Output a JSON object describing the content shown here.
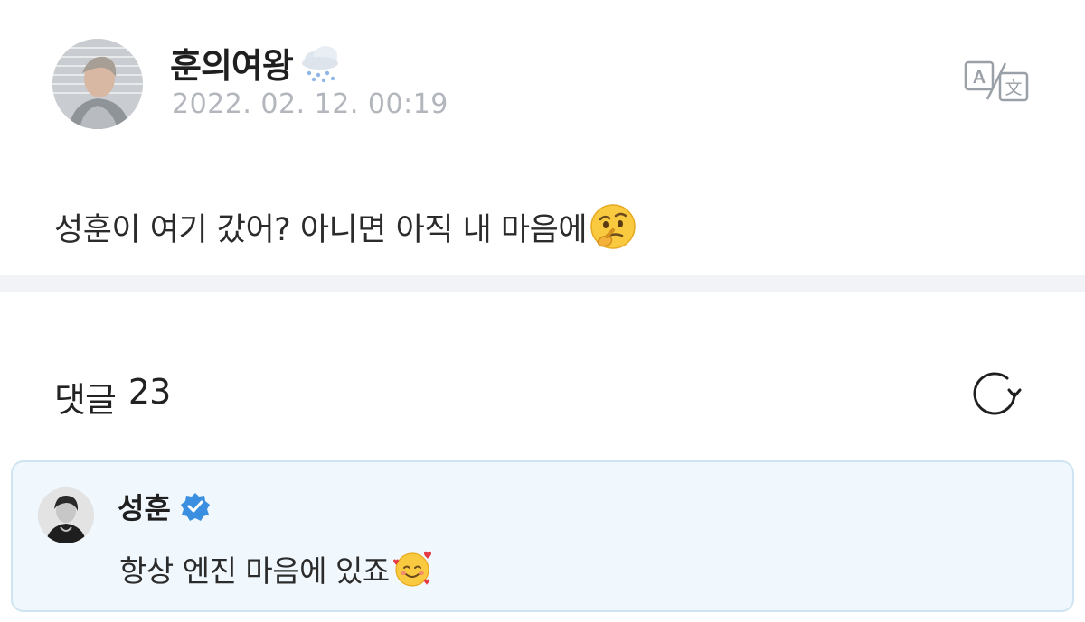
{
  "post": {
    "author": "훈의여왕",
    "author_emoji_icon": "cloud-snow-icon",
    "date": "2022. 02. 12. 00:19",
    "body": "성훈이 여기 갔어? 아니면 아직 내 마음에",
    "body_emoji_icon": "thinking-face-icon",
    "translate_icon": "translate-icon"
  },
  "comments": {
    "label": "댓글",
    "count": "23",
    "refresh_icon": "refresh-icon",
    "items": [
      {
        "author": "성훈",
        "verified": true,
        "text": "항상 엔진 마음에 있죠",
        "text_emoji_icon": "smiling-face-with-hearts-icon"
      }
    ]
  },
  "colors": {
    "accent_blue": "#3b8fe0",
    "comment_bg": "#f1f8fd",
    "comment_border": "#cfe4f2",
    "date_gray": "#b3b7bd",
    "divider": "#f2f3f6"
  }
}
